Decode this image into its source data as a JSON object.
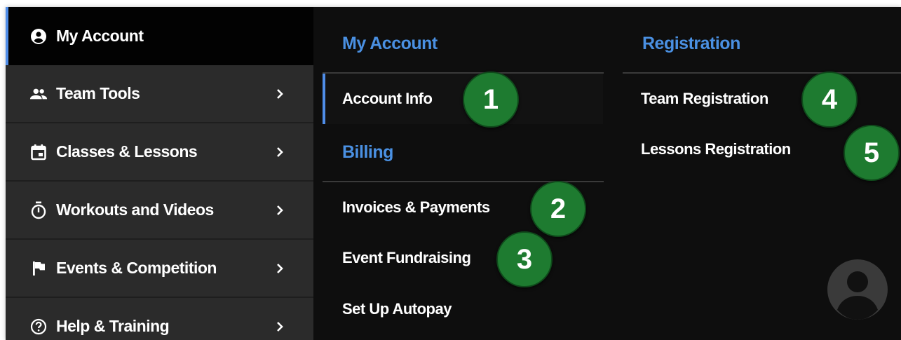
{
  "sidebar": {
    "items": [
      {
        "label": "My Account",
        "icon": "account-circle-icon",
        "active": true,
        "has_chevron": false
      },
      {
        "label": "Team Tools",
        "icon": "people-icon",
        "active": false,
        "has_chevron": true
      },
      {
        "label": "Classes & Lessons",
        "icon": "calendar-icon",
        "active": false,
        "has_chevron": true
      },
      {
        "label": "Workouts and Videos",
        "icon": "timer-icon",
        "active": false,
        "has_chevron": true
      },
      {
        "label": "Events & Competition",
        "icon": "flag-icon",
        "active": false,
        "has_chevron": true
      },
      {
        "label": "Help & Training",
        "icon": "help-circle-icon",
        "active": false,
        "has_chevron": true
      }
    ],
    "chevron": "›"
  },
  "account_column": {
    "heading": "My Account",
    "account_info": "Account Info",
    "billing_heading": "Billing",
    "invoices": "Invoices & Payments",
    "fundraising": "Event Fundraising",
    "autopay": "Set Up Autopay"
  },
  "registration_column": {
    "heading": "Registration",
    "team_registration": "Team Registration",
    "lessons_registration": "Lessons Registration"
  },
  "badges": [
    "1",
    "2",
    "3",
    "4",
    "5"
  ],
  "colors": {
    "accent": "#4a90e2",
    "badge": "#1e7b30",
    "sidebar": "#2b2b2b",
    "panel": "#0e0e0e"
  }
}
